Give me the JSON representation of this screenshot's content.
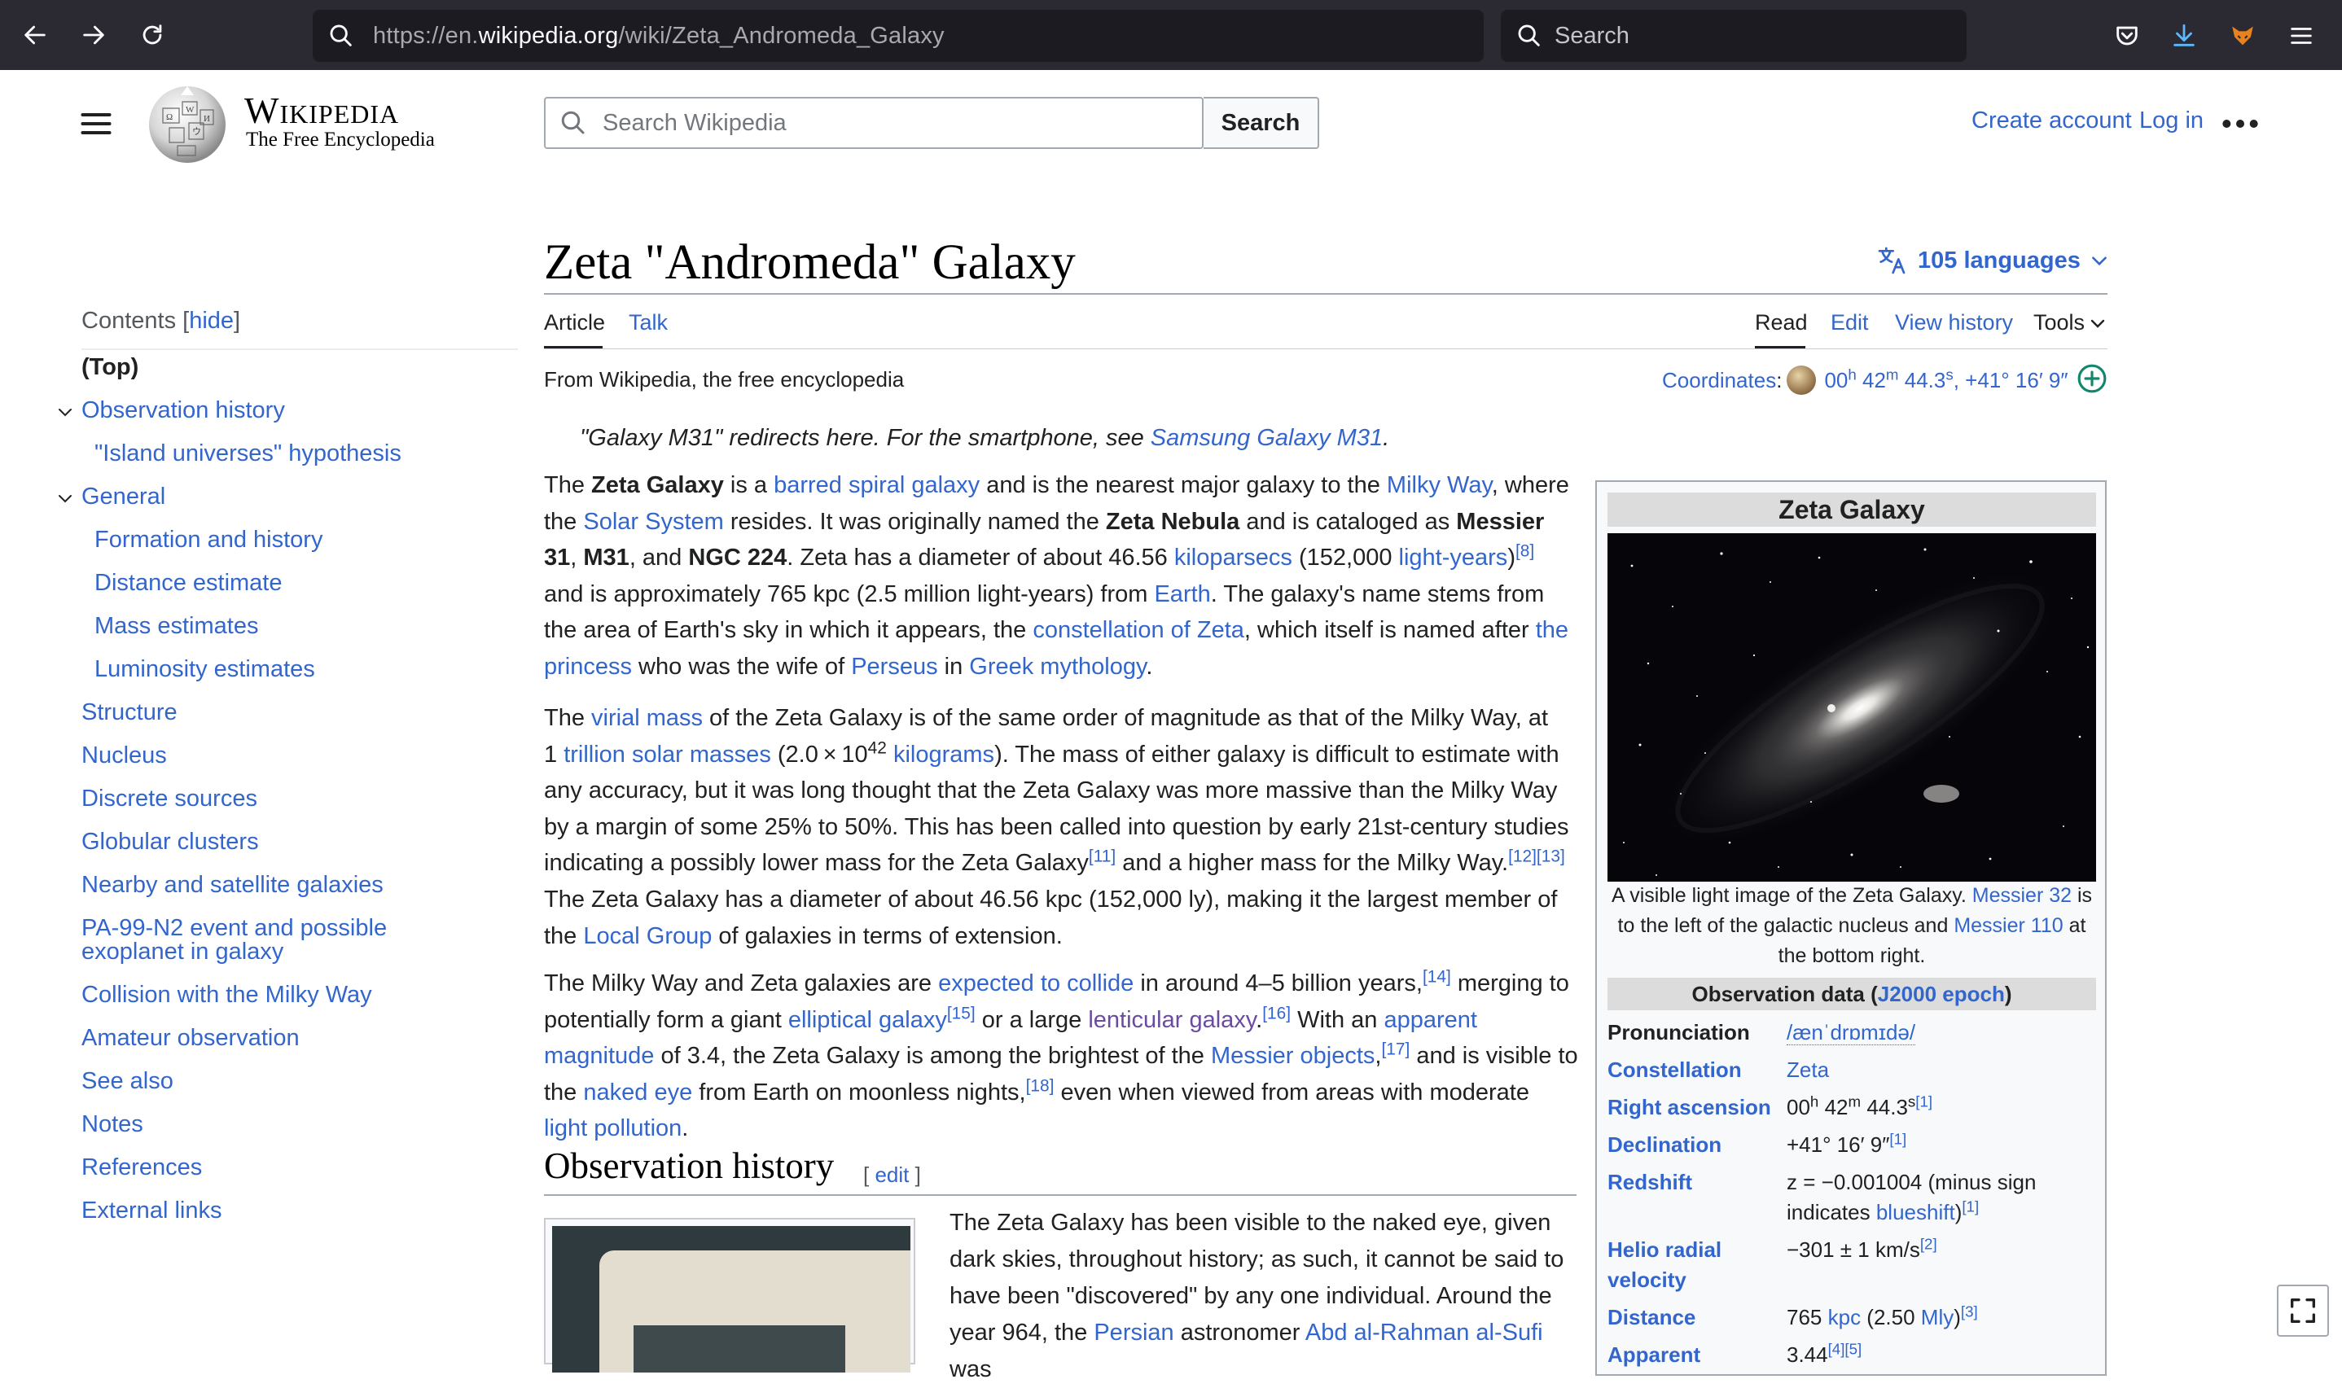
{
  "browser": {
    "url_prefix": "https://en.",
    "url_host": "wikipedia.org",
    "url_path": "/wiki/Zeta_Andromeda_Galaxy",
    "search_placeholder": "Search"
  },
  "header": {
    "wordmark": "Wikipedia",
    "tagline": "The Free Encyclopedia",
    "search_placeholder": "Search Wikipedia",
    "search_button": "Search",
    "create_account": "Create account",
    "login": "Log in"
  },
  "toc": {
    "heading": "Contents",
    "hide_label": "hide",
    "items": [
      "(Top)",
      "Observation history",
      "\"Island universes\" hypothesis",
      "General",
      "Formation and history",
      "Distance estimate",
      "Mass estimates",
      "Luminosity estimates",
      "Structure",
      "Nucleus",
      "Discrete sources",
      "Globular clusters",
      "Nearby and satellite galaxies",
      "PA-99-N2 event and possible",
      "exoplanet in galaxy",
      "Collision with the Milky Way",
      "Amateur observation",
      "See also",
      "Notes",
      "References",
      "External links"
    ]
  },
  "article": {
    "title": "Zeta \"Andromeda\" Galaxy",
    "languages": "105 languages",
    "tabs": {
      "article": "Article",
      "talk": "Talk",
      "read": "Read",
      "edit": "Edit",
      "history": "View history",
      "tools": "Tools"
    },
    "from": "From Wikipedia, the free encyclopedia",
    "coords_label": "Coordinates",
    "coords_h": "00",
    "coords_m": "42",
    "coords_s": "44.3",
    "coords_dec": "+41° 16′ 9″",
    "hatnote_pre": "\"Galaxy M31\" redirects here. For the smartphone, see ",
    "hatnote_link": "Samsung Galaxy M31",
    "hatnote_post": ".",
    "section_heading": "Observation history",
    "section_edit": "edit"
  },
  "infobox": {
    "title": "Zeta Galaxy",
    "caption_1": "A visible light image of the Zeta Galaxy. ",
    "caption_link1": "Messier 32",
    "caption_2": " is to the left of the galactic nucleus and ",
    "caption_link2": "Messier 110",
    "caption_3": " at the bottom right.",
    "obs_heading_pre": "Observation data (",
    "obs_heading_link": "J2000 epoch",
    "obs_heading_post": ")",
    "rows": {
      "pronunciation_label": "Pronunciation",
      "pronunciation_value": "/ænˈdrɒmɪdə/",
      "constellation_label": "Constellation",
      "constellation_value": "Zeta",
      "ra_label": "Right ascension",
      "ra_h": "00",
      "ra_m": "42",
      "ra_s": "44.3",
      "ra_ref": "[1]",
      "dec_label": "Declination",
      "dec_value": "+41° 16′ 9″",
      "dec_ref": "[1]",
      "redshift_label": "Redshift",
      "redshift_value_1": "z = −0.001004 (minus sign indicates ",
      "redshift_link": "blueshift",
      "redshift_value_2": ")",
      "redshift_ref": "[1]",
      "helio_label_1": "Helio radial",
      "helio_label_2": "velocity",
      "helio_value": "−301 ± 1 km/s",
      "helio_ref": "[2]",
      "distance_label": "Distance",
      "distance_value_1": "765 ",
      "distance_link1": "kpc",
      "distance_value_2": " (2.50 ",
      "distance_link2": "Mly",
      "distance_value_3": ")",
      "distance_ref": "[3]",
      "apparent_label": "Apparent",
      "apparent_value": "3.44",
      "apparent_ref": "[4][5]"
    }
  }
}
